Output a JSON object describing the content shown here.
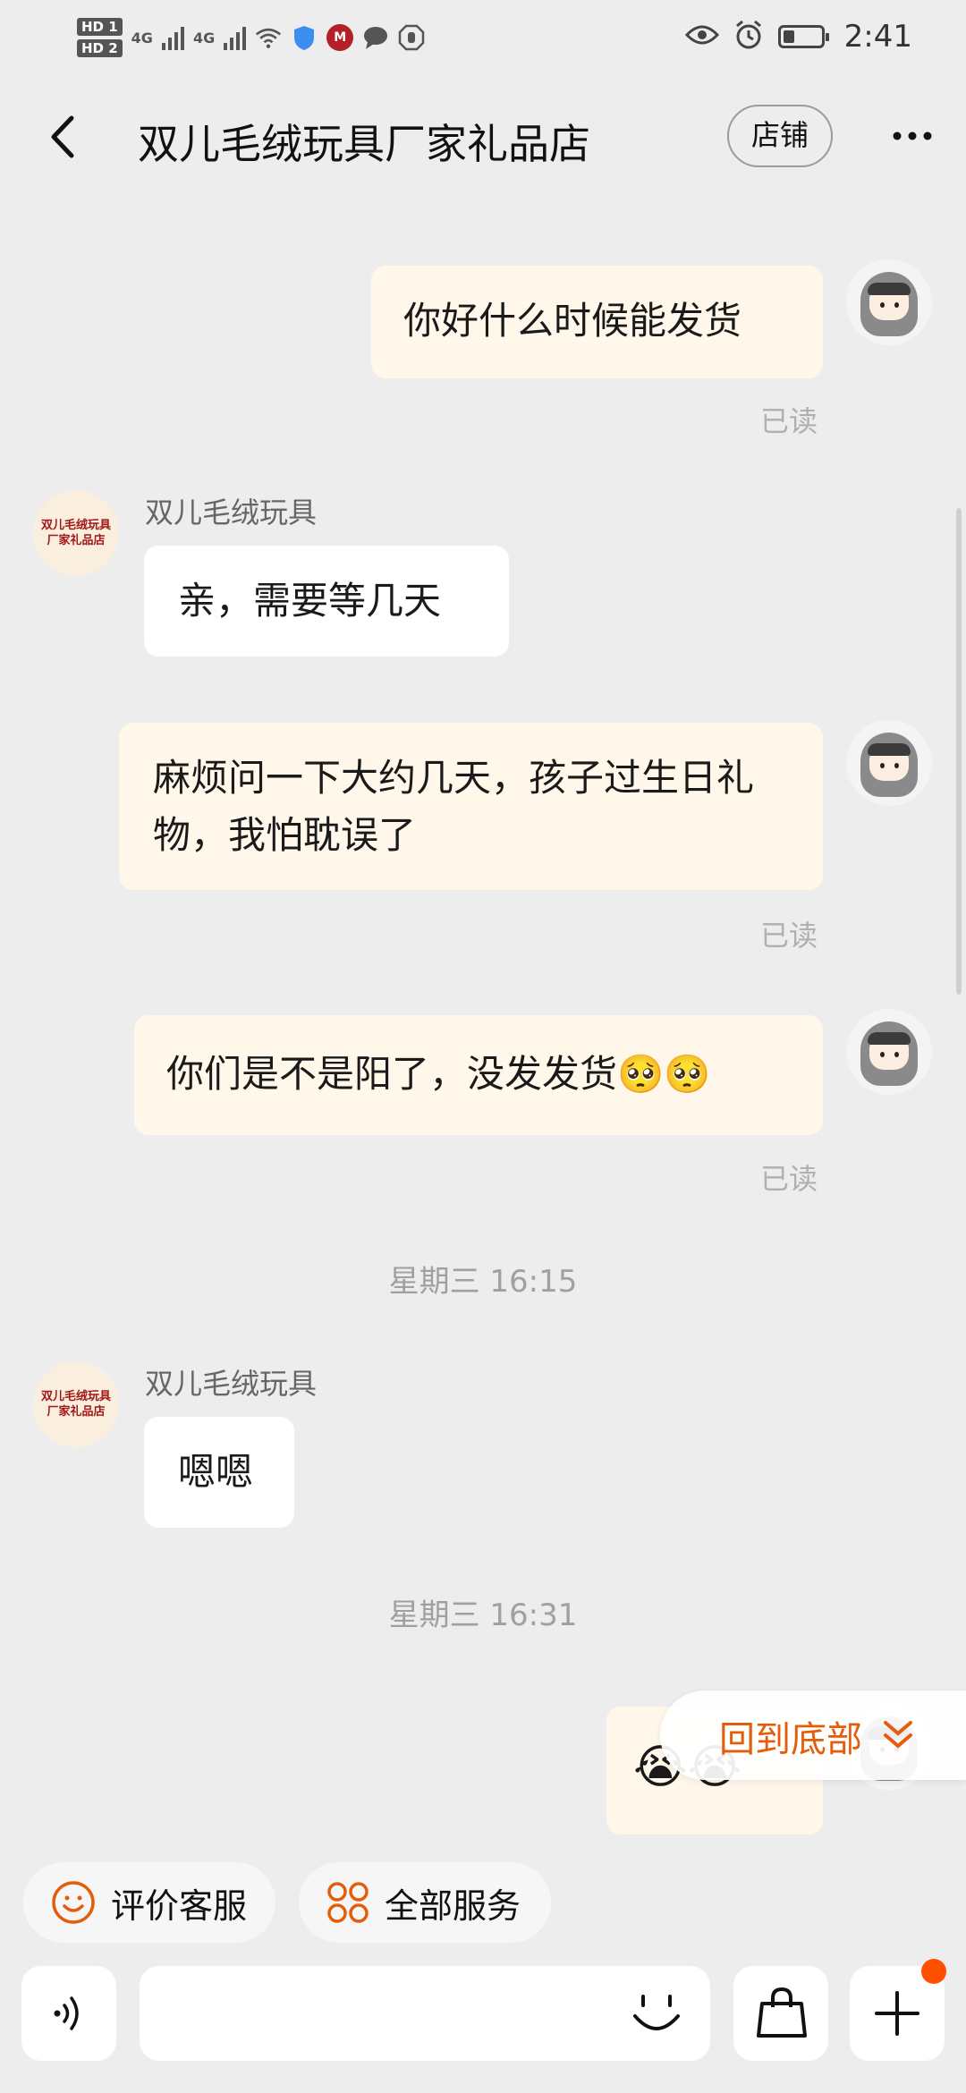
{
  "status_bar": {
    "hd1": "HD 1",
    "hd2": "HD 2",
    "signal1": "4G",
    "signal2": "4G",
    "time": "2:41",
    "icons": [
      "wifi-icon",
      "shield-icon",
      "app-icon",
      "message-icon",
      "hand-icon",
      "eye-icon",
      "alarm-icon",
      "battery-icon"
    ]
  },
  "header": {
    "back_icon": "‹",
    "title": "双儿毛绒玩具厂家礼品店",
    "shop_button": "店铺",
    "more_icon": "···"
  },
  "messages": [
    {
      "from": "me",
      "text": "你好什么时候能发货",
      "status": "已读"
    },
    {
      "from": "shop",
      "sender": "双儿毛绒玩具",
      "text": "亲，需要等几天"
    },
    {
      "from": "me",
      "text": "麻烦问一下大约几天，孩子过生日礼物，我怕耽误了",
      "status": "已读"
    },
    {
      "from": "me",
      "text": "你们是不是阳了，没发发货",
      "emoji": "🥺🥺",
      "status": "已读"
    },
    {
      "from": "shop",
      "sender": "双儿毛绒玩具",
      "text": "嗯嗯"
    },
    {
      "from": "me",
      "emoji": "😭😭"
    }
  ],
  "timestamps": [
    "星期三 16:15",
    "星期三 16:31"
  ],
  "shop_avatar_text": "双儿毛绒玩具厂家礼品店",
  "scroll_to_bottom": {
    "label": "回到底部",
    "icon": "chevron-double-down-icon"
  },
  "quick_actions": [
    {
      "label": "评价客服",
      "icon": "smile-icon"
    },
    {
      "label": "全部服务",
      "icon": "grid-icon"
    }
  ],
  "input_bar": {
    "voice_icon": "voice-icon",
    "input_value": "",
    "emoji_icon": "emoji-icon",
    "bag_icon": "shopping-bag-icon",
    "plus_icon": "plus-icon"
  },
  "colors": {
    "background": "#ededed",
    "my_bubble": "#fff7ea",
    "shop_bubble": "#ffffff",
    "accent": "#e35d0c",
    "badge": "#ff5000"
  }
}
